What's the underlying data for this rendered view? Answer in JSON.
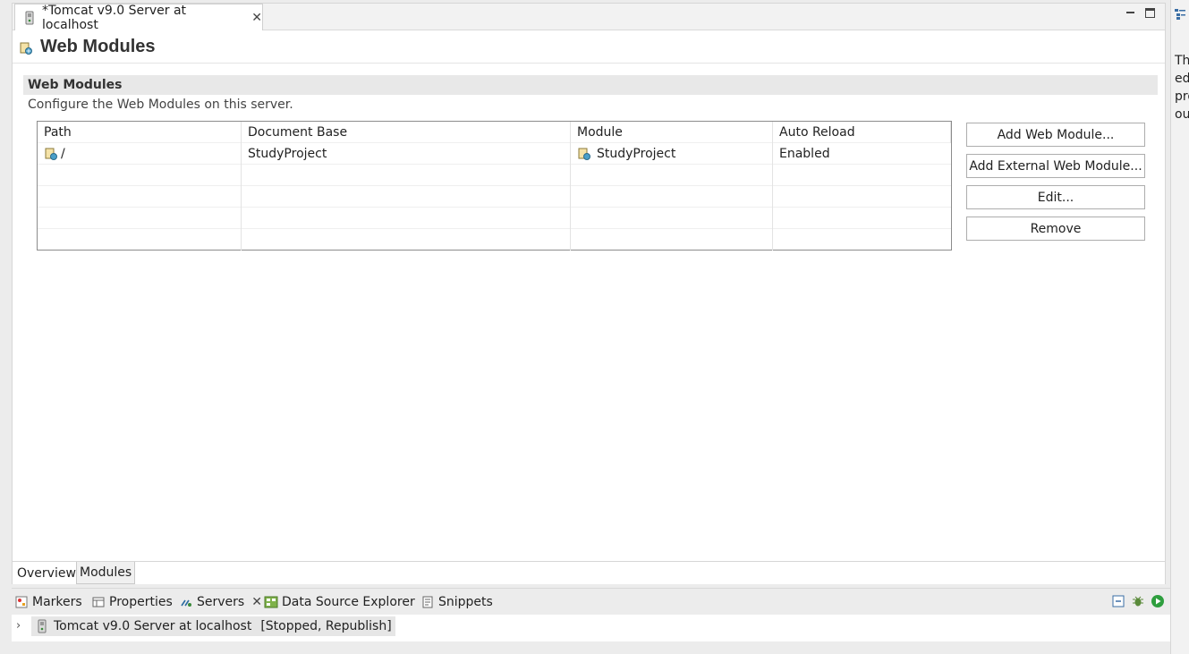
{
  "editor": {
    "tab_title": "*Tomcat v9.0 Server at localhost",
    "form_title": "Web Modules"
  },
  "section": {
    "title": "Web Modules",
    "description": "Configure the Web Modules on this server."
  },
  "table": {
    "columns": [
      "Path",
      "Document Base",
      "Module",
      "Auto Reload"
    ],
    "rows": [
      {
        "path": "/",
        "document_base": "StudyProject",
        "module": "StudyProject",
        "auto_reload": "Enabled"
      }
    ]
  },
  "buttons": {
    "add_web_module": "Add Web Module...",
    "add_external_web_module": "Add External Web Module...",
    "edit": "Edit...",
    "remove": "Remove"
  },
  "page_tabs": [
    "Overview",
    "Modules"
  ],
  "active_page_tab": "Modules",
  "views": {
    "tabs": [
      "Markers",
      "Properties",
      "Servers",
      "Data Source Explorer",
      "Snippets"
    ],
    "active": "Servers"
  },
  "servers": {
    "items": [
      {
        "name": "Tomcat v9.0 Server at localhost",
        "status": "[Stopped, Republish]"
      }
    ]
  },
  "right_panel": {
    "text_lines": [
      "Th",
      "ed",
      "pro",
      "ou"
    ]
  },
  "colors": {
    "section_bg": "#e8e8e8",
    "editor_bg": "#ffffff",
    "frame_bg": "#ececec",
    "run_green": "#2e9e3e"
  }
}
